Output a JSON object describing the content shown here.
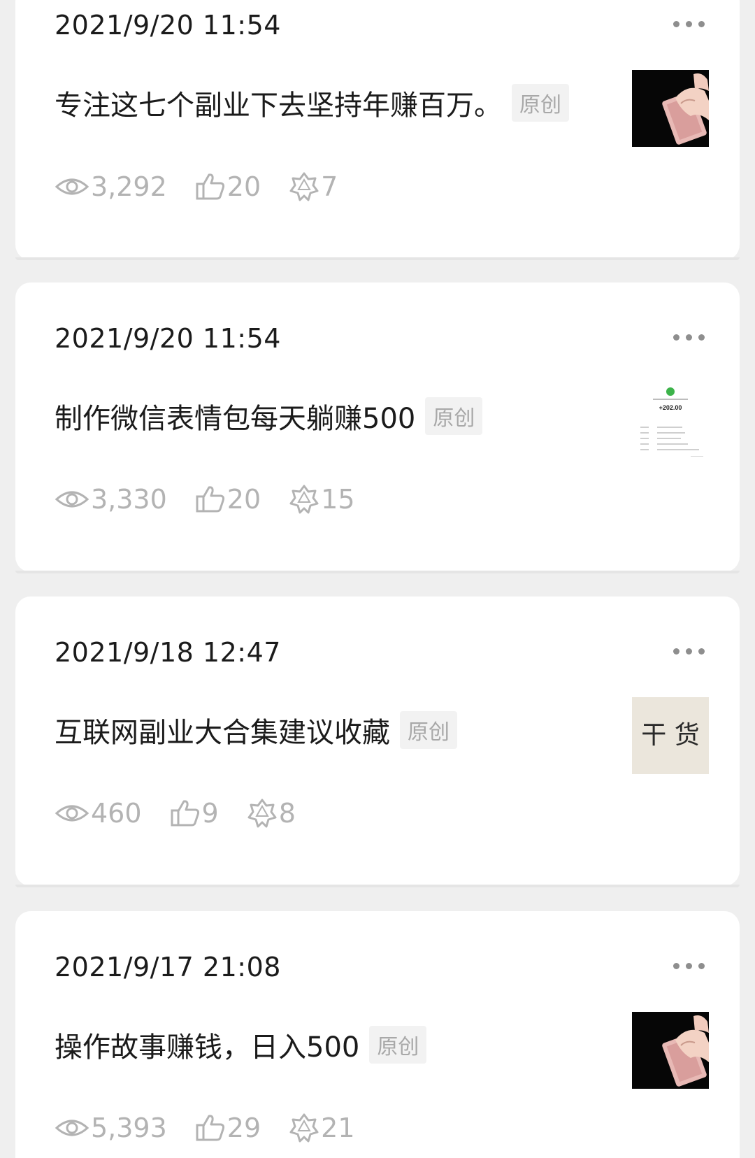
{
  "posts": [
    {
      "date": "2021/9/20 11:54",
      "title": "专注这七个副业下去坚持年赚百万。",
      "badge": "原创",
      "views": "3,292",
      "likes": "20",
      "shares": "7",
      "thumbnail": "hand-holding-cash-photo"
    },
    {
      "date": "2021/9/20 11:54",
      "title": "制作微信表情包每天躺赚500",
      "badge": "原创",
      "views": "3,330",
      "likes": "20",
      "shares": "15",
      "thumbnail": "payment-receipt-screenshot",
      "thumb_amount": "+202.00"
    },
    {
      "date": "2021/9/18 12:47",
      "title": "互联网副业大合集建议收藏",
      "badge": "原创",
      "views": "460",
      "likes": "9",
      "shares": "8",
      "thumbnail": "calligraphy-paper",
      "thumb_chars": "干  货"
    },
    {
      "date": "2021/9/17 21:08",
      "title": "操作故事赚钱，日入500",
      "badge": "原创",
      "views": "5,393",
      "likes": "29",
      "shares": "21",
      "thumbnail": "hand-holding-cash-photo"
    }
  ],
  "icons": {
    "views": "eye-icon",
    "likes": "thumbs-up-icon",
    "shares": "share-star-icon",
    "more": "more-dots-icon"
  },
  "colors": {
    "page_bg": "#efefef",
    "card_bg": "#ffffff",
    "text": "#1b1b1b",
    "muted": "#b3b3b3",
    "badge_bg": "#f2f2f2"
  }
}
